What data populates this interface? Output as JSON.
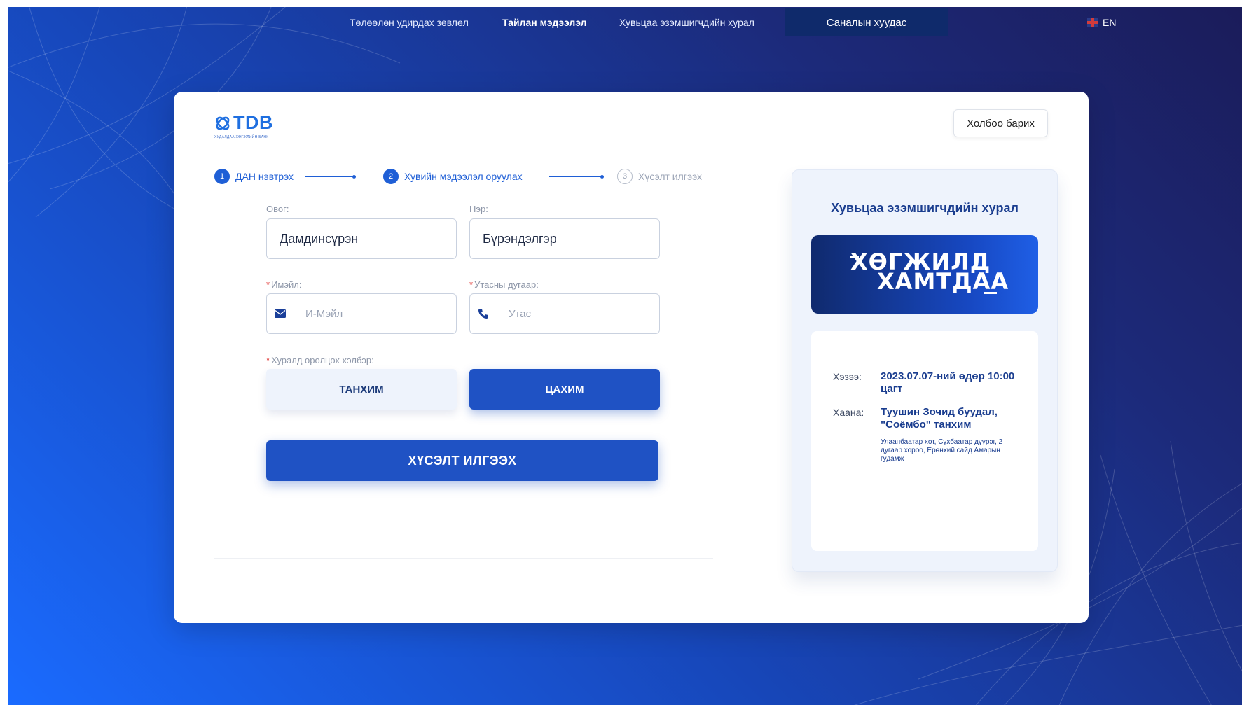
{
  "nav": {
    "links": [
      "Төлөөлөн удирдах зөвлөл",
      "Тайлан мэдээлэл",
      "Хувьцаа эзэмшигчдийн хурал"
    ],
    "cta": "Саналын хуудас",
    "lang": "EN"
  },
  "header": {
    "logo_text": "TDB",
    "logo_sub": "ХУДАЛДАА ХӨГЖЛИЙН БАНК",
    "contact_button": "Холбоо барих"
  },
  "steps": [
    {
      "num": "1",
      "label": "ДАН нэвтрэх",
      "state": "done"
    },
    {
      "num": "2",
      "label": "Хувийн мэдээлэл оруулах",
      "state": "current"
    },
    {
      "num": "3",
      "label": "Хүсэлт илгээх",
      "state": "todo"
    }
  ],
  "form": {
    "lastname": {
      "label": "Овог:",
      "value": "Дамдинсүрэн"
    },
    "firstname": {
      "label": "Нэр:",
      "value": "Бүрэндэлгэр"
    },
    "email": {
      "label": "Имэйл:",
      "placeholder": "И-Мэйл",
      "icon": "envelope-icon"
    },
    "phone": {
      "label": "Утасны дугаар:",
      "placeholder": "Утас",
      "icon": "phone-icon"
    },
    "mode": {
      "label": "Хуралд оролцох хэлбэр:",
      "options": [
        "ТАНХИМ",
        "ЦАХИМ"
      ],
      "selected": "ЦАХИМ"
    },
    "required_mark": "*",
    "submit": "ХҮСЭЛТ ИЛГЭЭХ"
  },
  "panel": {
    "title": "Хувьцаа эзэмшигчдийн хурал",
    "banner_line1": "ХӨГЖИЛД",
    "banner_line2": "ХАМТДАА",
    "when_label": "Хэзээ:",
    "when_value": "2023.07.07-ний өдөр 10:00 цагт",
    "where_label": "Хаана:",
    "where_value": "Туушин Зочид буудал, \"Соёмбо\" танхим",
    "address": "Улаанбаатар хот, Сүхбаатар дүүрэг, 2 дугаар хороо, Ерөнхий сайд Амарын гудамж"
  },
  "colors": {
    "primary": "#1f52c4",
    "accent": "#1f5fd6",
    "nav_cta_bg": "#0f2a6b",
    "required": "#e0302e"
  }
}
